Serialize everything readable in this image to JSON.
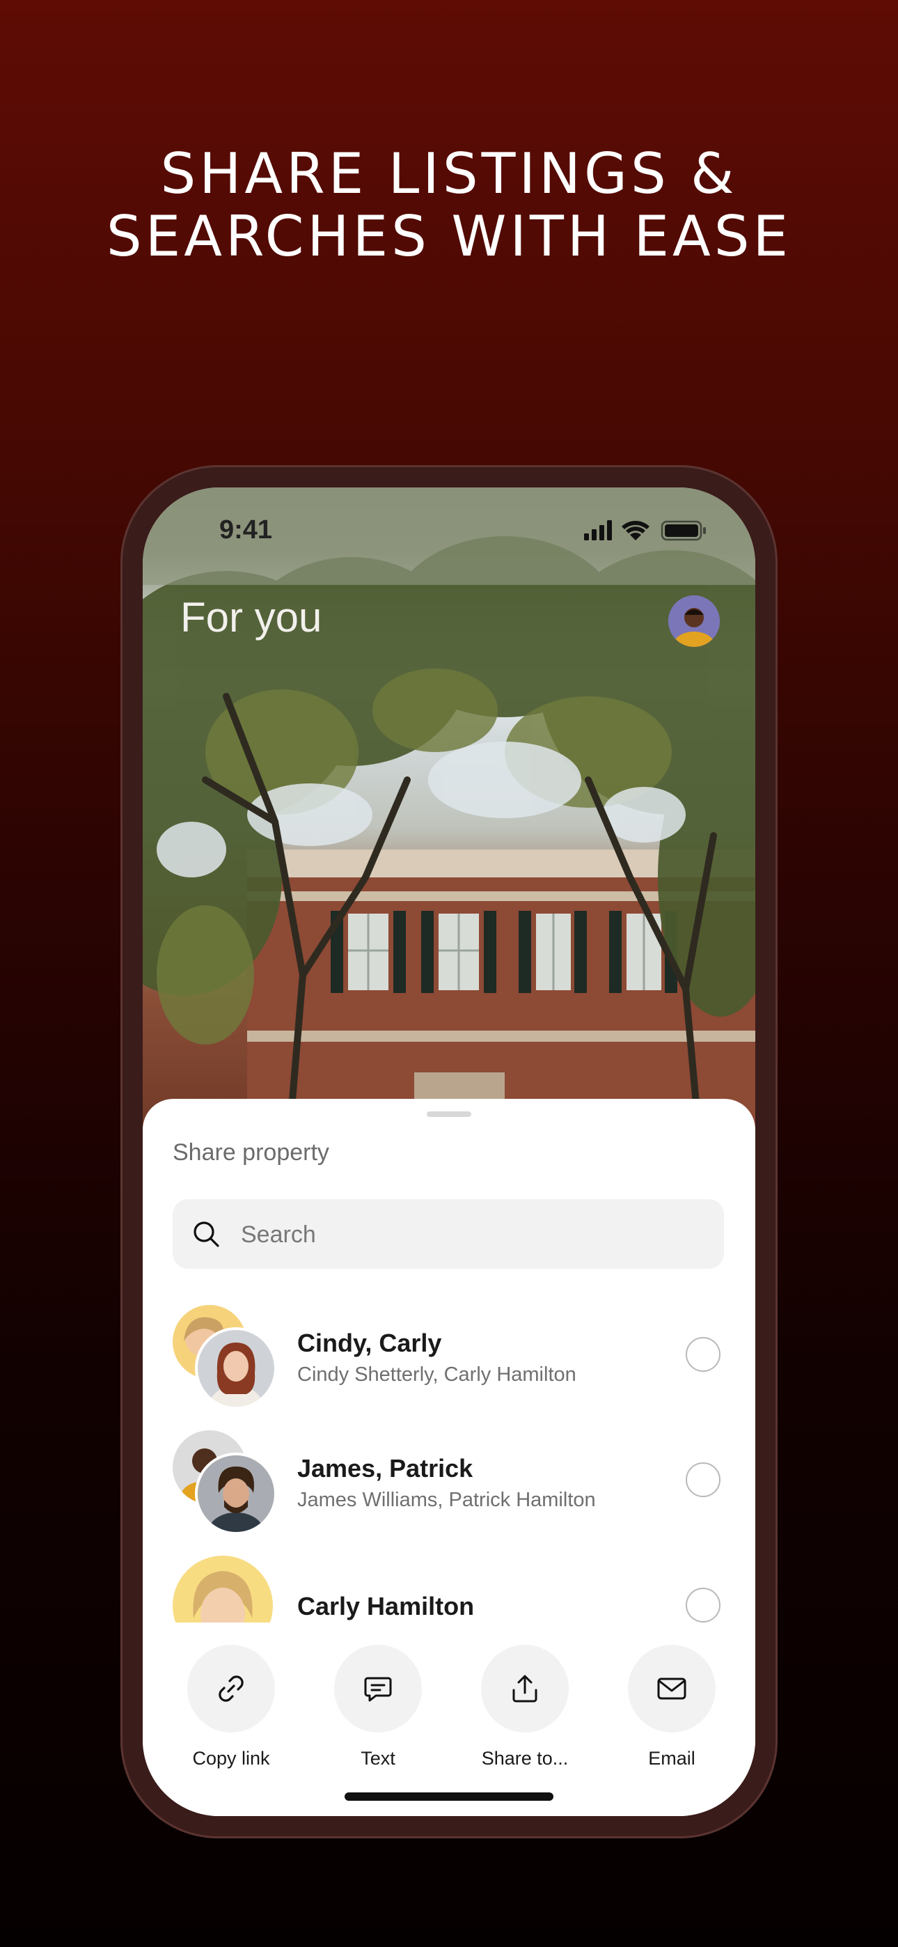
{
  "headline": {
    "line1": "SHARE LISTINGS &",
    "line2": "SEARCHES WITH EASE"
  },
  "status_bar": {
    "time": "9:41",
    "icons": [
      "signal-icon",
      "wifi-icon",
      "battery-icon"
    ]
  },
  "header": {
    "title": "For you",
    "avatar": "profile-avatar"
  },
  "share_sheet": {
    "title": "Share property",
    "search": {
      "placeholder": "Search",
      "value": ""
    },
    "contacts": [
      {
        "name": "Cindy, Carly",
        "subtitle": "Cindy Shetterly, Carly Hamilton",
        "selected": false
      },
      {
        "name": "James, Patrick",
        "subtitle": "James Williams, Patrick Hamilton",
        "selected": false
      },
      {
        "name": "Carly Hamilton",
        "subtitle": "",
        "selected": false
      }
    ],
    "actions": [
      {
        "label": "Copy link",
        "icon": "link-icon"
      },
      {
        "label": "Text",
        "icon": "message-icon"
      },
      {
        "label": "Share to...",
        "icon": "share-icon"
      },
      {
        "label": "Email",
        "icon": "mail-icon"
      }
    ]
  },
  "colors": {
    "background_top": "#5e0c04",
    "background_bottom": "#050000",
    "sheet": "#ffffff",
    "action_circle": "#f2f2f2"
  }
}
